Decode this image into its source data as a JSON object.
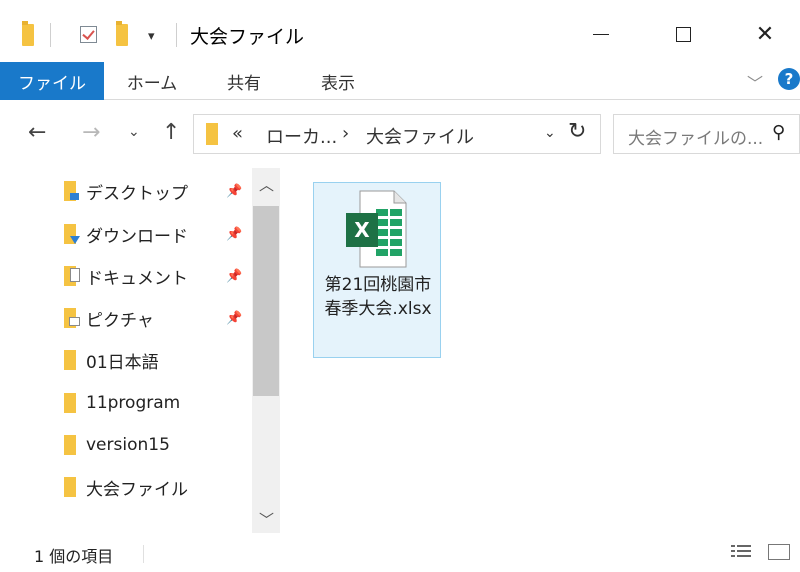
{
  "window": {
    "title": "大会ファイル",
    "controls": {
      "minimize": "—",
      "maximize": "☐",
      "close": "✕"
    }
  },
  "ribbon": {
    "tabs": [
      {
        "label": "ファイル",
        "active": true
      },
      {
        "label": "ホーム"
      },
      {
        "label": "共有"
      },
      {
        "label": "表示"
      }
    ],
    "help_label": "?"
  },
  "address": {
    "breadcrumb_overflow": "«",
    "segments": [
      "ローカ...",
      "大会ファイル"
    ],
    "separator": "›"
  },
  "search": {
    "placeholder": "大会ファイルの..."
  },
  "navigation": {
    "items": [
      {
        "label": "デスクトップ",
        "pinned": true
      },
      {
        "label": "ダウンロード",
        "pinned": true
      },
      {
        "label": "ドキュメント",
        "pinned": true
      },
      {
        "label": "ピクチャ",
        "pinned": true
      },
      {
        "label": "01日本語"
      },
      {
        "label": "11program"
      },
      {
        "label": "version15"
      },
      {
        "label": "大会ファイル"
      }
    ]
  },
  "files": [
    {
      "name": "第21回桃園市春季大会.xlsx",
      "icon": "excel-file-icon",
      "selected": true
    }
  ],
  "status": {
    "item_count": "1 個の項目"
  },
  "colors": {
    "accent": "#1979ca",
    "selection_bg": "#e5f3fb",
    "folder": "#f5c342",
    "excel_green": "#1e7145"
  }
}
